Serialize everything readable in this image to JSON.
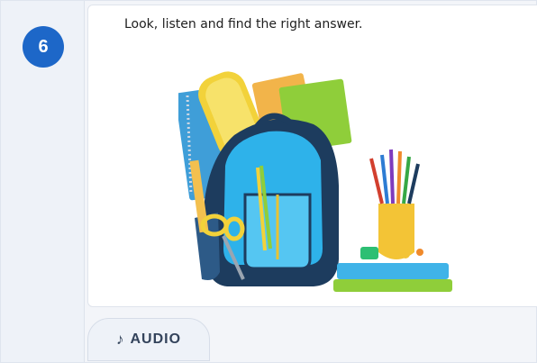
{
  "question": {
    "number": "6",
    "prompt": "Look, listen and find the right answer."
  },
  "illustration": {
    "icon": "backpack-with-school-supplies"
  },
  "audio": {
    "icon": "music-note-icon",
    "label": "AUDIO"
  }
}
